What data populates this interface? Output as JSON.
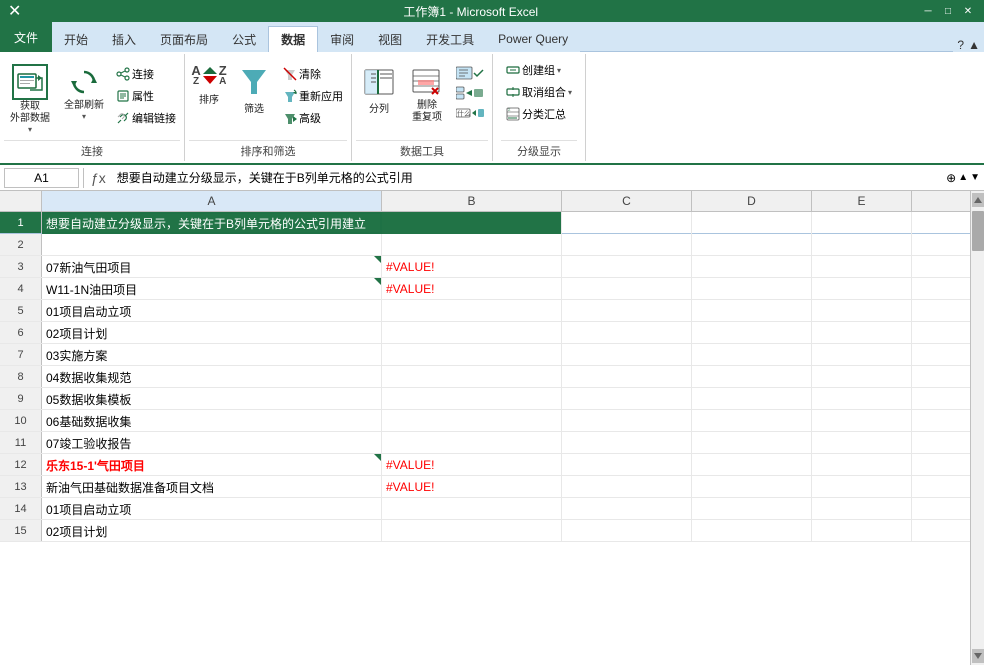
{
  "app": {
    "title": "Microsoft Excel",
    "file_name": "工作簿1 - Microsoft Excel"
  },
  "tabs": [
    {
      "label": "文件",
      "active": false
    },
    {
      "label": "开始",
      "active": false
    },
    {
      "label": "插入",
      "active": false
    },
    {
      "label": "页面布局",
      "active": false
    },
    {
      "label": "公式",
      "active": false
    },
    {
      "label": "数据",
      "active": true
    },
    {
      "label": "审阅",
      "active": false
    },
    {
      "label": "视图",
      "active": false
    },
    {
      "label": "开发工具",
      "active": false
    },
    {
      "label": "Power Query",
      "active": false
    }
  ],
  "ribbon": {
    "groups": [
      {
        "label": "连接",
        "items": [
          {
            "type": "tall",
            "icon": "📊",
            "label": "获取\n外部数据",
            "dropdown": true
          },
          {
            "type": "tall",
            "icon": "🔄",
            "label": "全部刷新",
            "dropdown": true
          },
          {
            "type": "side",
            "items": [
              {
                "icon": "🔗",
                "label": "连接"
              },
              {
                "icon": "📋",
                "label": "属性"
              },
              {
                "icon": "✏️",
                "label": "编辑链接"
              }
            ]
          }
        ]
      },
      {
        "label": "排序和筛选",
        "items": [
          {
            "type": "sort",
            "label": "排序"
          },
          {
            "type": "tall",
            "icon": "🔽",
            "label": "筛选"
          },
          {
            "type": "side",
            "items": [
              {
                "icon": "❌",
                "label": "清除"
              },
              {
                "icon": "🔁",
                "label": "重新应用"
              },
              {
                "icon": "⬆",
                "label": "高级"
              }
            ]
          }
        ]
      },
      {
        "label": "数据工具",
        "items": [
          {
            "type": "tall",
            "icon": "☰",
            "label": "分列"
          },
          {
            "type": "tall",
            "icon": "🗑",
            "label": "删除\n重复项"
          },
          {
            "type": "side",
            "items": [
              {
                "icon": "✓",
                "label": ""
              },
              {
                "icon": "📊",
                "label": ""
              },
              {
                "icon": "🔗",
                "label": ""
              }
            ]
          }
        ]
      },
      {
        "label": "分级显示",
        "items": [
          {
            "type": "side",
            "items": [
              {
                "icon": "📦",
                "label": "创建组",
                "dropdown": true
              },
              {
                "icon": "📤",
                "label": "取消组合",
                "dropdown": true
              },
              {
                "icon": "📋",
                "label": "分类汇总"
              }
            ]
          }
        ]
      }
    ]
  },
  "formula_bar": {
    "cell_ref": "A1",
    "formula": "想要自动建立分级显示，关键在于B列单元格的公式引用"
  },
  "columns": [
    "A",
    "B",
    "C",
    "D",
    "E"
  ],
  "rows": [
    {
      "num": 1,
      "cells": [
        "想要自动建立分级显示，关键在于B列单元格的公式引用建立",
        "",
        "",
        "",
        ""
      ],
      "style": "header"
    },
    {
      "num": 2,
      "cells": [
        "",
        "",
        "",
        "",
        ""
      ],
      "style": ""
    },
    {
      "num": 3,
      "cells": [
        "07新油气田项目",
        "#VALUE!",
        "",
        "",
        ""
      ],
      "style": "normal",
      "has_triangle": true
    },
    {
      "num": 4,
      "cells": [
        "W11-1N油田项目",
        "#VALUE!",
        "",
        "",
        ""
      ],
      "style": "normal",
      "has_triangle": true
    },
    {
      "num": 5,
      "cells": [
        "01项目启动立项",
        "",
        "",
        "",
        ""
      ],
      "style": "normal"
    },
    {
      "num": 6,
      "cells": [
        "02项目计划",
        "",
        "",
        "",
        ""
      ],
      "style": "normal"
    },
    {
      "num": 7,
      "cells": [
        "03实施方案",
        "",
        "",
        "",
        ""
      ],
      "style": "normal"
    },
    {
      "num": 8,
      "cells": [
        "04数据收集规范",
        "",
        "",
        "",
        ""
      ],
      "style": "normal"
    },
    {
      "num": 9,
      "cells": [
        "05数据收集模板",
        "",
        "",
        "",
        ""
      ],
      "style": "normal"
    },
    {
      "num": 10,
      "cells": [
        "06基础数据收集",
        "",
        "",
        "",
        ""
      ],
      "style": "normal"
    },
    {
      "num": 11,
      "cells": [
        "07竣工验收报告",
        "",
        "",
        "",
        ""
      ],
      "style": "normal"
    },
    {
      "num": 12,
      "cells": [
        "乐东15-1'气田项目",
        "#VALUE!",
        "",
        "",
        ""
      ],
      "style": "red",
      "has_triangle": true
    },
    {
      "num": 13,
      "cells": [
        "新油气田基础数据准备项目文档",
        "#VALUE!",
        "",
        "",
        ""
      ],
      "style": "normal"
    },
    {
      "num": 14,
      "cells": [
        "01项目启动立项",
        "",
        "",
        "",
        ""
      ],
      "style": "normal"
    },
    {
      "num": 15,
      "cells": [
        "02项目计划",
        "",
        "",
        "",
        ""
      ],
      "style": "normal"
    }
  ]
}
